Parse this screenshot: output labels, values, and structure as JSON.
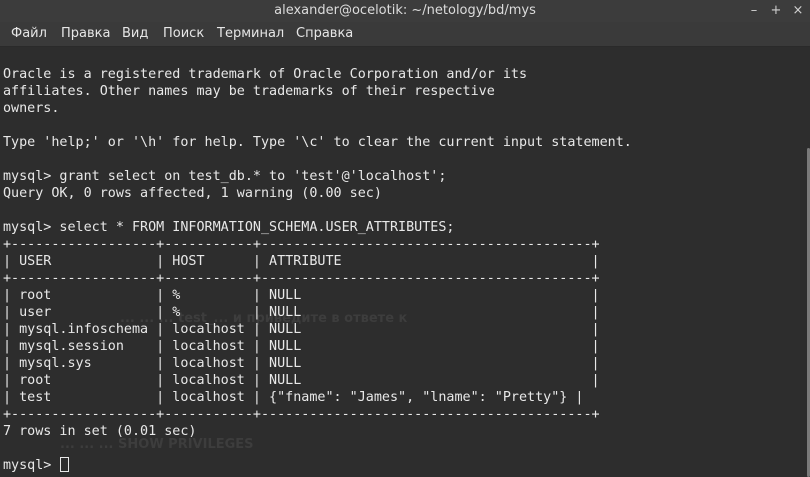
{
  "window": {
    "title": "alexander@ocelotik: ~/netology/bd/mys",
    "minimize": "–",
    "maximize": "+",
    "close": "×"
  },
  "menu": [
    "Файл",
    "Правка",
    "Вид",
    "Поиск",
    "Терминал",
    "Справка"
  ],
  "ghost": {
    "line1": "... ... ... test_... и приведите в ответе к",
    "line2": "... ... ... SHOW PRIVILEGES"
  },
  "terminal": {
    "lines": [
      "Oracle is a registered trademark of Oracle Corporation and/or its",
      "affiliates. Other names may be trademarks of their respective",
      "owners.",
      "",
      "Type 'help;' or '\\h' for help. Type '\\c' to clear the current input statement.",
      "",
      "mysql> grant select on test_db.* to 'test'@'localhost';",
      "Query OK, 0 rows affected, 1 warning (0.00 sec)",
      "",
      "mysql> select * FROM INFORMATION_SCHEMA.USER_ATTRIBUTES;",
      "+------------------+-----------+-----------------------------------------+",
      "| USER             | HOST      | ATTRIBUTE                               |",
      "+------------------+-----------+-----------------------------------------+",
      "| root             | %         | NULL                                    |",
      "| user             | %         | NULL                                    |",
      "| mysql.infoschema | localhost | NULL                                    |",
      "| mysql.session    | localhost | NULL                                    |",
      "| mysql.sys        | localhost | NULL                                    |",
      "| root             | localhost | NULL                                    |",
      "| test             | localhost | {\"fname\": \"James\", \"lname\": \"Pretty\"} |",
      "+------------------+-----------+-----------------------------------------+",
      "7 rows in set (0.01 sec)",
      ""
    ],
    "prompt": "mysql> "
  }
}
